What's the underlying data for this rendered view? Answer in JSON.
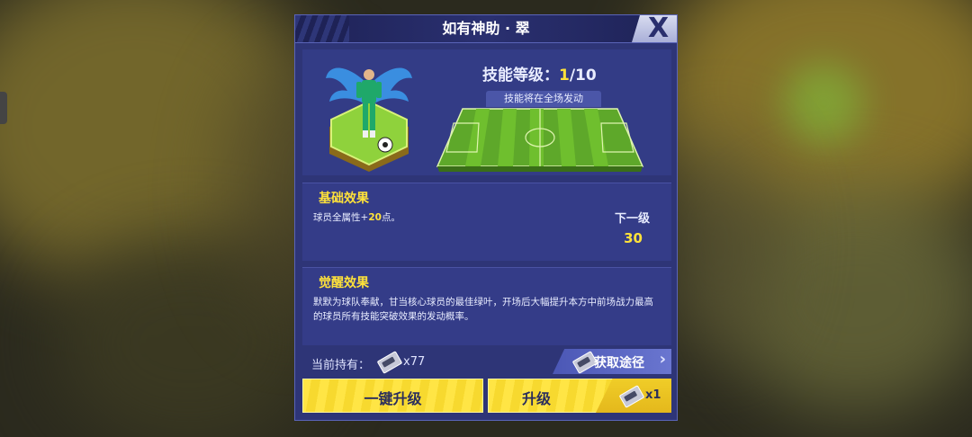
{
  "dialog": {
    "title": "如有神助 · 翠",
    "close_label": "X"
  },
  "skill": {
    "level_label": "技能等级：",
    "level_current": "1",
    "level_max": "/10",
    "field_note": "技能将在全场发动"
  },
  "basic_effect": {
    "title": "基础效果",
    "text_prefix": "球员全属性+",
    "text_value": "20",
    "text_suffix": "点。",
    "next_label": "下一级",
    "next_value": "30"
  },
  "awaken_effect": {
    "title": "觉醒效果",
    "text": "默默为球队奉献，甘当核心球员的最佳绿叶，开场后大幅提升本方中前场战力最高的球员所有技能突破效果的发动概率。"
  },
  "holdings": {
    "label": "当前持有：",
    "count": "x77",
    "acquire_label": "获取途径",
    "acquire_arrow": "›"
  },
  "buttons": {
    "one_click_upgrade": "一键升级",
    "upgrade": "升级",
    "upgrade_cost": "x1"
  },
  "colors": {
    "accent_yellow": "#ffe23a",
    "panel_blue": "#2e3577",
    "pitch_green": "#6fbf2e"
  }
}
